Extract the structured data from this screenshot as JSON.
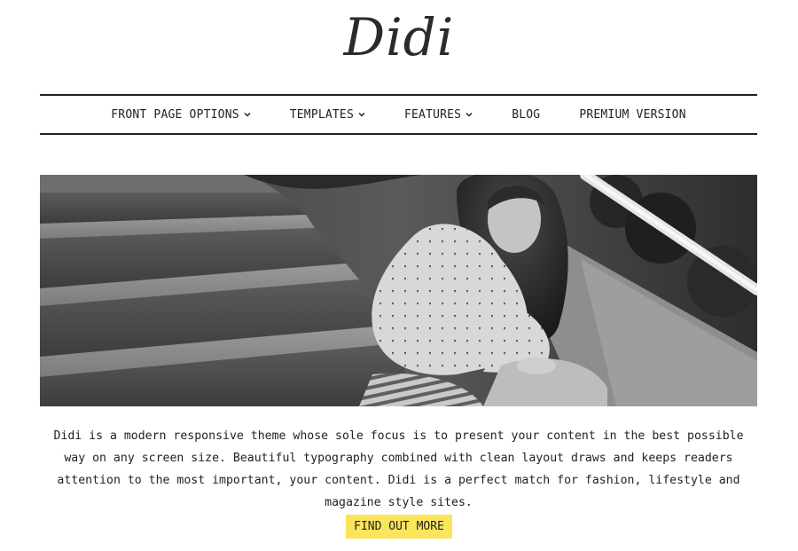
{
  "site": {
    "title": "Didi"
  },
  "nav": {
    "items": [
      {
        "label": "FRONT PAGE OPTIONS",
        "has_dropdown": true,
        "icon": "chevron-down-icon"
      },
      {
        "label": "TEMPLATES",
        "has_dropdown": true,
        "icon": "chevron-down-icon"
      },
      {
        "label": "FEATURES",
        "has_dropdown": true,
        "icon": "chevron-down-icon"
      },
      {
        "label": "BLOG",
        "has_dropdown": false
      },
      {
        "label": "PREMIUM VERSION",
        "has_dropdown": false
      }
    ]
  },
  "hero": {
    "image_icon": "photo-woman-on-stairs",
    "tone": "black-and-white"
  },
  "intro": {
    "text": "Didi is a modern responsive theme whose sole focus is to present your content in the best possible way on any screen size. Beautiful typography combined with clean layout draws and keeps readers attention to the most important, your content. Didi is a perfect match for fashion, lifestyle and magazine style sites."
  },
  "cta": {
    "label": "FIND OUT MORE"
  },
  "colors": {
    "accent": "#fbe55c",
    "text": "#222222",
    "background": "#ffffff"
  }
}
